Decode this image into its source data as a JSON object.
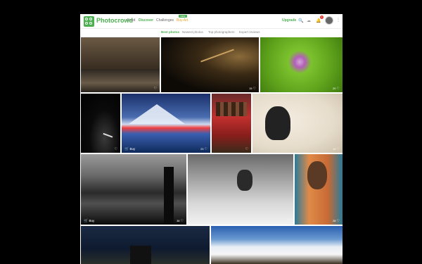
{
  "app": {
    "brand": "Photocrowd",
    "nav": [
      "Feed",
      "Discover",
      "Challenges",
      "Buy Art"
    ],
    "badge": "NEW",
    "upgrade": "Upgrade",
    "notif_count": "1"
  },
  "subnav": [
    "Best photos",
    "Newest photos",
    "Top photographers",
    "Expert reviews"
  ],
  "tiles": [
    {
      "stats": "",
      "buy": ""
    },
    {
      "stats": "15",
      "buy": ""
    },
    {
      "stats": "20",
      "buy": ""
    },
    {
      "stats": "",
      "buy": ""
    },
    {
      "stats": "23",
      "buy": "Buy"
    },
    {
      "stats": "",
      "buy": ""
    },
    {
      "stats": "12",
      "buy": ""
    },
    {
      "stats": "38",
      "buy": "Buy"
    },
    {
      "stats": "",
      "buy": ""
    },
    {
      "stats": "28",
      "buy": ""
    },
    {
      "stats": "",
      "buy": ""
    },
    {
      "stats": "",
      "buy": ""
    }
  ],
  "icons": {
    "search": "search-icon",
    "upload": "upload-icon",
    "bell": "bell-icon",
    "menu": "more-icon",
    "cart": "cart-icon",
    "heart": "heart-icon"
  }
}
